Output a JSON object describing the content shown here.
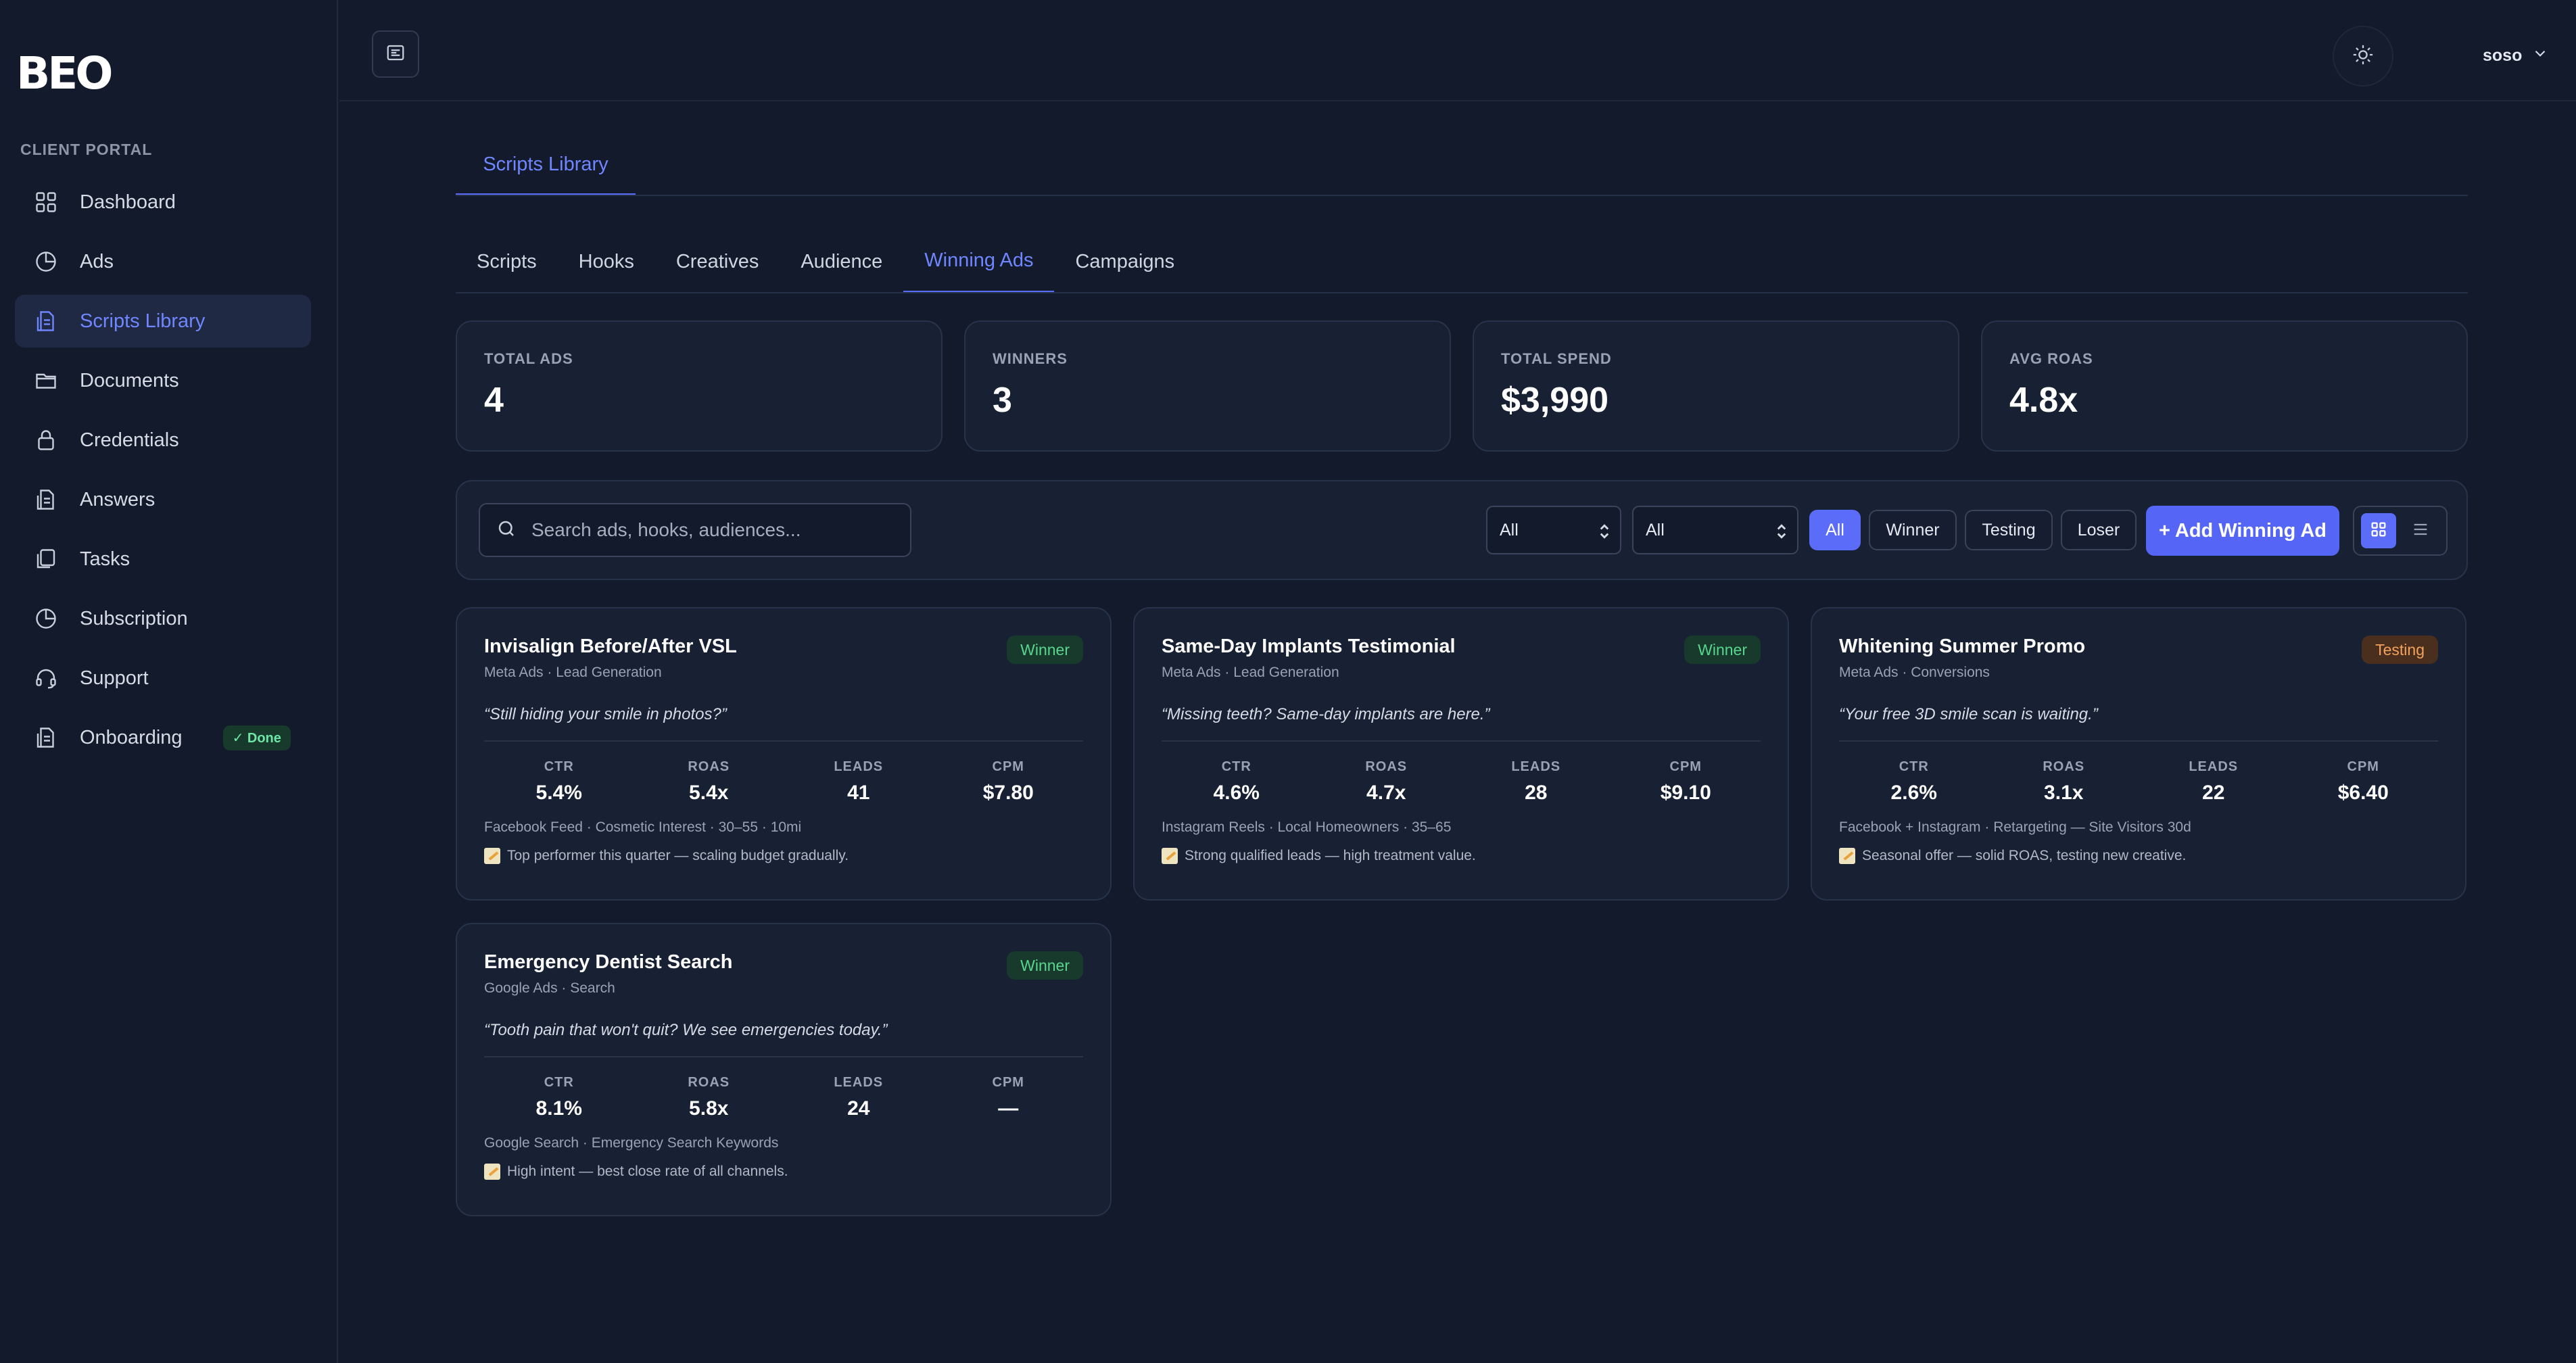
{
  "brand": {
    "logo_text": "BEO"
  },
  "sidebar": {
    "section_label": "CLIENT PORTAL",
    "items": [
      {
        "label": "Dashboard",
        "icon": "dashboard-grid-icon",
        "active": false
      },
      {
        "label": "Ads",
        "icon": "pie-chart-icon",
        "active": false
      },
      {
        "label": "Scripts Library",
        "icon": "document-icon",
        "active": true
      },
      {
        "label": "Documents",
        "icon": "folder-icon",
        "active": false
      },
      {
        "label": "Credentials",
        "icon": "lock-icon",
        "active": false
      },
      {
        "label": "Answers",
        "icon": "document-icon",
        "active": false
      },
      {
        "label": "Tasks",
        "icon": "copy-icon",
        "active": false
      },
      {
        "label": "Subscription",
        "icon": "pie-chart-icon",
        "active": false
      },
      {
        "label": "Support",
        "icon": "headset-icon",
        "active": false
      },
      {
        "label": "Onboarding",
        "icon": "document-icon",
        "active": false,
        "badge": "Done"
      }
    ]
  },
  "header": {
    "user_name": "soso"
  },
  "page": {
    "tab": "Scripts Library",
    "sub_tabs": [
      {
        "label": "Scripts",
        "active": false
      },
      {
        "label": "Hooks",
        "active": false
      },
      {
        "label": "Creatives",
        "active": false
      },
      {
        "label": "Audience",
        "active": false
      },
      {
        "label": "Winning Ads",
        "active": true
      },
      {
        "label": "Campaigns",
        "active": false
      }
    ]
  },
  "stats": [
    {
      "label": "TOTAL ADS",
      "value": "4"
    },
    {
      "label": "WINNERS",
      "value": "3"
    },
    {
      "label": "TOTAL SPEND",
      "value": "$3,990"
    },
    {
      "label": "AVG ROAS",
      "value": "4.8x"
    }
  ],
  "toolbar": {
    "search_placeholder": "Search ads, hooks, audiences...",
    "filter_1_value": "All",
    "filter_2_value": "All",
    "chips": [
      {
        "label": "All",
        "active": true
      },
      {
        "label": "Winner",
        "active": false
      },
      {
        "label": "Testing",
        "active": false
      },
      {
        "label": "Loser",
        "active": false
      }
    ],
    "add_label": "+ Add Winning Ad",
    "view_mode": "grid"
  },
  "metric_labels": {
    "ctr": "CTR",
    "roas": "ROAS",
    "leads": "LEADS",
    "cpm": "CPM"
  },
  "ads": [
    {
      "title": "Invisalign Before/After VSL",
      "meta": "Meta Ads · Lead Generation",
      "status": "Winner",
      "quote": "“Still hiding your smile in photos?”",
      "ctr": "5.4%",
      "roas": "5.4x",
      "leads": "41",
      "cpm": "$7.80",
      "targeting": "Facebook Feed · Cosmetic Interest · 30–55 · 10mi",
      "note": "Top performer this quarter — scaling budget gradually."
    },
    {
      "title": "Same-Day Implants Testimonial",
      "meta": "Meta Ads · Lead Generation",
      "status": "Winner",
      "quote": "“Missing teeth? Same-day implants are here.”",
      "ctr": "4.6%",
      "roas": "4.7x",
      "leads": "28",
      "cpm": "$9.10",
      "targeting": "Instagram Reels · Local Homeowners · 35–65",
      "note": "Strong qualified leads — high treatment value."
    },
    {
      "title": "Whitening Summer Promo",
      "meta": "Meta Ads · Conversions",
      "status": "Testing",
      "quote": "“Your free 3D smile scan is waiting.”",
      "ctr": "2.6%",
      "roas": "3.1x",
      "leads": "22",
      "cpm": "$6.40",
      "targeting": "Facebook + Instagram · Retargeting — Site Visitors 30d",
      "note": "Seasonal offer — solid ROAS, testing new creative."
    },
    {
      "title": "Emergency Dentist Search",
      "meta": "Google Ads · Search",
      "status": "Winner",
      "quote": "“Tooth pain that won't quit? We see emergencies today.”",
      "ctr": "8.1%",
      "roas": "5.8x",
      "leads": "24",
      "cpm": "—",
      "targeting": "Google Search · Emergency Search Keywords",
      "note": "High intent — best close rate of all channels."
    }
  ],
  "colors": {
    "accent": "#5b6cf9",
    "background": "#131a2b",
    "card": "#182033",
    "winner": "#58d68d",
    "testing": "#f3a35b"
  }
}
